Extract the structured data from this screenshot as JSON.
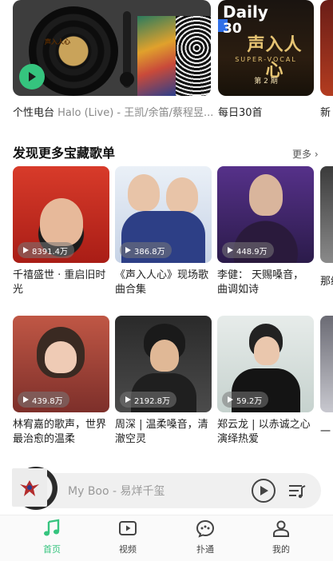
{
  "top_cards": {
    "radio": {
      "caption": "个性电台",
      "caption_sub": "Halo (Live) - 王凯/余笛/蔡程昱...",
      "vinyl_label": "声入人心"
    },
    "daily": {
      "caption": "每日30首",
      "tag": "Daily",
      "tag_num": "30",
      "cover_title": "声入人心",
      "cover_sub": "SUPER-VOCAL",
      "cover_episode": "第 2 期"
    },
    "peek": {
      "caption": "新"
    }
  },
  "section": {
    "title": "发现更多宝藏歌单",
    "more_label": "更多"
  },
  "playlists": [
    {
      "count": "8391.4万",
      "title": "千禧盛世 · 重启旧时光"
    },
    {
      "count": "386.8万",
      "title": "《声入人心》现场歌曲合集"
    },
    {
      "count": "448.9万",
      "title": "李健： 天赐嗓音，曲调如诗"
    },
    {
      "count": "439.8万",
      "title": "林宥嘉的歌声，世界最治愈的温柔"
    },
    {
      "count": "2192.8万",
      "title": "周深 | 温柔嗓音，清澈空灵"
    },
    {
      "count": "59.2万",
      "title": "郑云龙 | 以赤诚之心演绎热爱"
    }
  ],
  "peek_captions": {
    "row1": "那级",
    "row2": "一"
  },
  "mini_player": {
    "title": "My Boo - 易烊千玺",
    "cover_text": "MY BOO"
  },
  "bottom_nav": [
    {
      "label": "首页",
      "icon": "music-note-icon",
      "active": true
    },
    {
      "label": "视频",
      "icon": "video-icon",
      "active": false
    },
    {
      "label": "扑通",
      "icon": "chat-bubble-icon",
      "active": false
    },
    {
      "label": "我的",
      "icon": "user-icon",
      "active": false
    }
  ],
  "colors": {
    "accent": "#35c47e",
    "daily_blue": "#2f6fe8",
    "gold": "#e6c473"
  }
}
